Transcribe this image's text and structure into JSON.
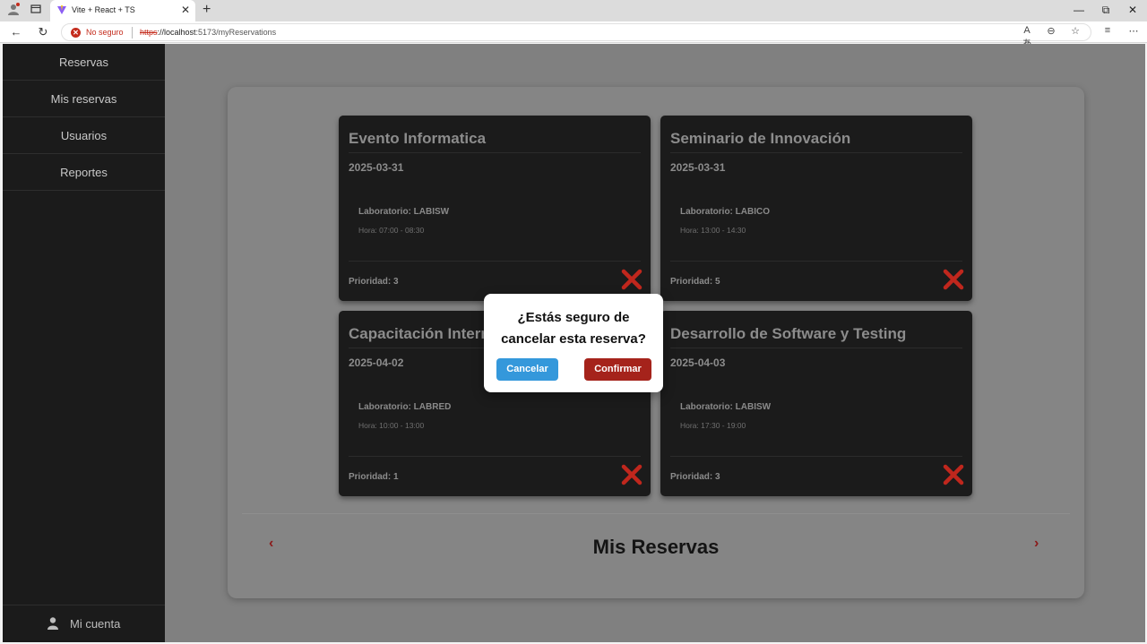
{
  "browser": {
    "tab_title": "Vite + React + TS",
    "security_label": "No seguro",
    "url_scheme": "https",
    "url_host": "://localhost",
    "url_rest": ":5173/myReservations"
  },
  "sidebar": {
    "items": [
      {
        "label": "Reservas"
      },
      {
        "label": "Mis reservas"
      },
      {
        "label": "Usuarios"
      },
      {
        "label": "Reportes"
      }
    ],
    "account_label": "Mi cuenta"
  },
  "reservations": [
    {
      "title": "Evento Informatica",
      "date": "2025-03-31",
      "lab": "Laboratorio: LABISW",
      "hours": "Hora: 07:00 - 08:30",
      "priority": "Prioridad: 3"
    },
    {
      "title": "Seminario de Innovación",
      "date": "2025-03-31",
      "lab": "Laboratorio: LABICO",
      "hours": "Hora: 13:00 - 14:30",
      "priority": "Prioridad: 5"
    },
    {
      "title": "Capacitación Intern",
      "date": "2025-04-02",
      "lab": "Laboratorio: LABRED",
      "hours": "Hora: 10:00 - 13:00",
      "priority": "Prioridad: 1"
    },
    {
      "title": "Desarrollo de Software y Testing",
      "date": "2025-04-03",
      "lab": "Laboratorio: LABISW",
      "hours": "Hora: 17:30 - 19:00",
      "priority": "Prioridad: 3"
    }
  ],
  "page": {
    "title": "Mis Reservas",
    "prev_arrow": "‹",
    "next_arrow": "›"
  },
  "modal": {
    "line1": "¿Estás seguro de",
    "line2": "cancelar esta reserva?",
    "cancel_label": "Cancelar",
    "confirm_label": "Confirmar"
  },
  "colors": {
    "delete_icon": "#c0271d",
    "cancel_button": "#3498db",
    "confirm_button": "#a5231b"
  }
}
